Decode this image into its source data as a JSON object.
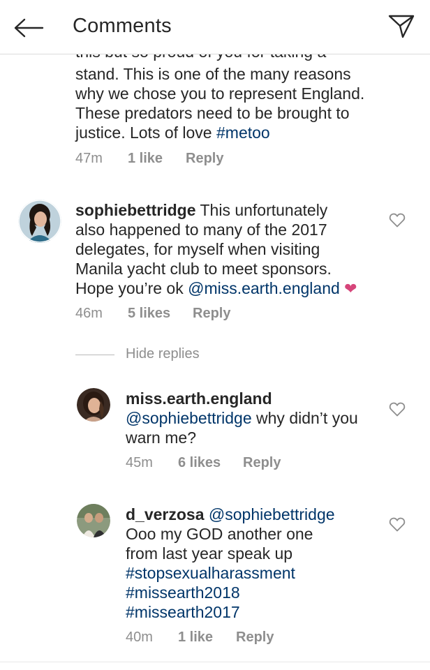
{
  "header": {
    "title": "Comments",
    "back_icon": "arrow-left-icon",
    "direct_icon": "paper-plane-icon"
  },
  "comment1": {
    "text_line0": "this but so proud of you for taking a",
    "text_line1": "stand. This is one of the many reasons",
    "text_line2": "why we chose you to represent England.",
    "text_line3": "These predators need to be brought to",
    "text_line4_prefix": "justice. Lots of love ",
    "hashtag": "#metoo",
    "time": "47m",
    "likes": "1 like",
    "reply": "Reply"
  },
  "comment2": {
    "username": "sophiebettridge",
    "text_line1": " This unfortunately",
    "text_line2": "also happened to many of the 2017",
    "text_line3": "delegates, for myself when visiting",
    "text_line4": "Manila yacht club to meet sponsors.",
    "text_line5_prefix": "Hope you’re ok ",
    "mention": "@miss.earth.england",
    "emoji": "❤",
    "time": "46m",
    "likes": "5 likes",
    "reply": "Reply"
  },
  "hide_replies": "Hide replies",
  "reply1": {
    "username": "miss.earth.england",
    "mention": "@sophiebettridge",
    "text_line2_suffix": " why didn’t you",
    "text_line3": "warn me?",
    "time": "45m",
    "likes": "6 likes",
    "reply": "Reply"
  },
  "reply2": {
    "username": "d_verzosa",
    "mention": "@sophiebettridge",
    "text_line2": "Ooo my GOD another one",
    "text_line3": "from last year speak up",
    "hashtag1": "#stopsexualharassment",
    "hashtag2": "#missearth2018",
    "hashtag3": "#missearth2017",
    "time": "40m",
    "likes": "1 like",
    "reply": "Reply"
  },
  "colors": {
    "link": "#003569",
    "text": "#262626",
    "meta": "#8e8e8e",
    "emoji_heart": "#d6457a"
  }
}
